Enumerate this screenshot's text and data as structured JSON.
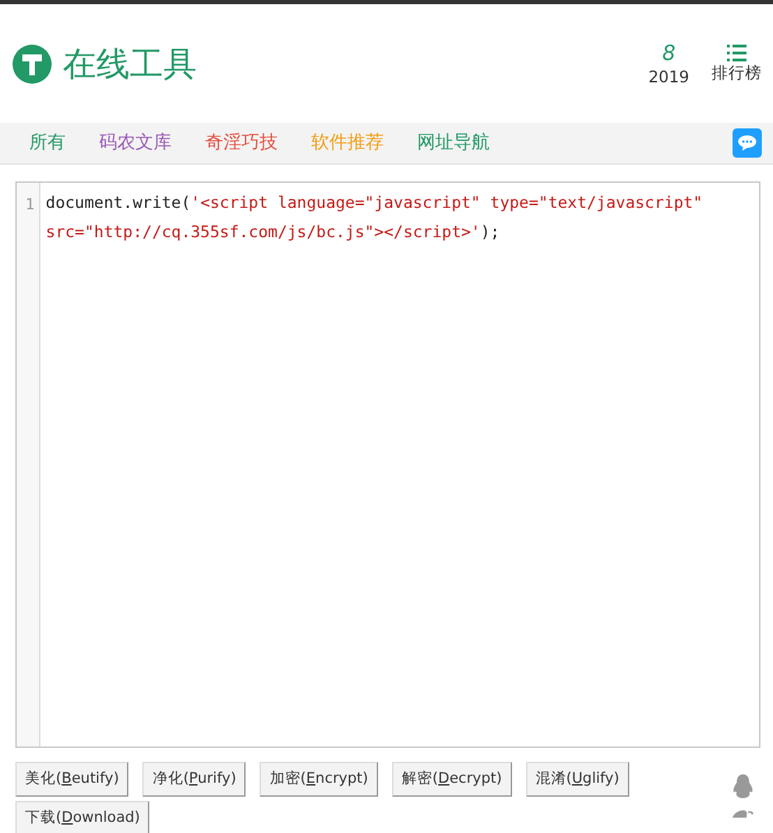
{
  "header": {
    "title": "在线工具",
    "date": {
      "day": "8",
      "year": "2019"
    },
    "ranking": {
      "label": "排行榜"
    }
  },
  "nav": [
    {
      "label": "所有",
      "color": "#229966"
    },
    {
      "label": "码农文库",
      "color": "#9b59b6"
    },
    {
      "label": "奇淫巧技",
      "color": "#e74c3c"
    },
    {
      "label": "软件推荐",
      "color": "#f39c12"
    },
    {
      "label": "网址导航",
      "color": "#229966"
    }
  ],
  "editor": {
    "lines": [
      {
        "number": "1",
        "tokens": [
          {
            "text": "document.write(",
            "kind": "plain"
          },
          {
            "text": "'<script language=\"javascript\" type=\"text/javascript\" src=\"http://cq.355sf.com/js/bc.js\"></script>'",
            "kind": "string"
          },
          {
            "text": ");",
            "kind": "plain"
          }
        ]
      }
    ]
  },
  "buttons": [
    {
      "prefix": "美化(",
      "hotkey": "B",
      "suffix": "eutify)"
    },
    {
      "prefix": "净化(",
      "hotkey": "P",
      "suffix": "urify)"
    },
    {
      "prefix": "加密(",
      "hotkey": "E",
      "suffix": "ncrypt)"
    },
    {
      "prefix": "解密(",
      "hotkey": "D",
      "suffix": "ecrypt)"
    },
    {
      "prefix": "混淆(",
      "hotkey": "U",
      "suffix": "glify)"
    },
    {
      "prefix": "下载(",
      "hotkey": "D",
      "suffix": "ownload)"
    }
  ]
}
